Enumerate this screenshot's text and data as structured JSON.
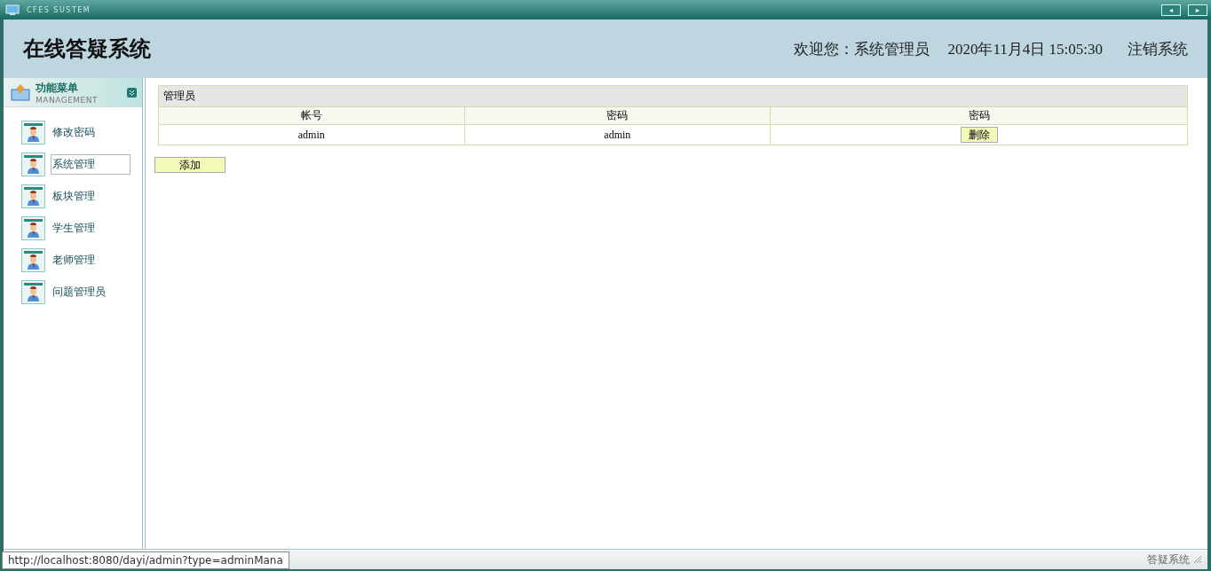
{
  "window": {
    "title": "CFES SUSTEM",
    "nav_buttons": [
      "◄",
      "►"
    ]
  },
  "header": {
    "app_title": "在线答疑系统",
    "welcome": "欢迎您：系统管理员",
    "datetime": "2020年11月4日 15:05:30",
    "logout": "注销系统"
  },
  "sidebar": {
    "title": "功能菜单",
    "subtitle": "MANAGEMENT",
    "items": [
      {
        "label": "修改密码",
        "selected": false
      },
      {
        "label": "系统管理",
        "selected": true
      },
      {
        "label": "板块管理",
        "selected": false
      },
      {
        "label": "学生管理",
        "selected": false
      },
      {
        "label": "老师管理",
        "selected": false
      },
      {
        "label": "问题管理员",
        "selected": false
      }
    ]
  },
  "table": {
    "caption": "管理员",
    "columns": [
      "帐号",
      "密码",
      "密码"
    ],
    "rows": [
      {
        "cells": [
          "admin",
          "admin"
        ],
        "action": "删除"
      }
    ]
  },
  "add_button": "添加",
  "status_bar": {
    "url": "http://localhost:8080/dayi/admin?type=adminMana",
    "label": "答疑系统"
  }
}
